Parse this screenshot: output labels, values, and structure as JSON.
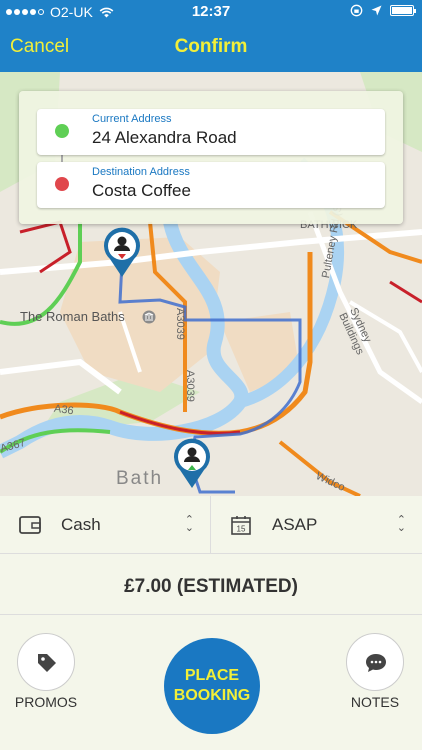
{
  "status_bar": {
    "carrier": "O2-UK",
    "time": "12:37"
  },
  "nav": {
    "cancel_label": "Cancel",
    "title": "Confirm"
  },
  "address": {
    "current_label": "Current Address",
    "current_value": "24 Alexandra Road",
    "destination_label": "Destination Address",
    "destination_value": "Costa Coffee"
  },
  "map": {
    "labels": {
      "roman_baths": "The Roman Baths",
      "bath": "Bath",
      "a3039_1": "A3039",
      "a3039_2": "A3039",
      "a36": "A36",
      "a367": "A367",
      "pulteney": "Pulteney Rd (South)",
      "sydney": "Sydney Buildings",
      "bathwick": "BATHWICK",
      "widcombe": "Widco"
    },
    "colors": {
      "green_dot": "#5fcf55",
      "red_dot": "#e0474c",
      "route": "#3f6fcf",
      "traffic_red": "#c8202a",
      "traffic_orange": "#f08a1d"
    }
  },
  "payment": {
    "method": "Cash",
    "when": "ASAP",
    "calendar_day": "15"
  },
  "price": "£7.00 (ESTIMATED)",
  "actions": {
    "promos": "PROMOS",
    "place_line1": "PLACE",
    "place_line2": "BOOKING",
    "notes": "NOTES"
  }
}
